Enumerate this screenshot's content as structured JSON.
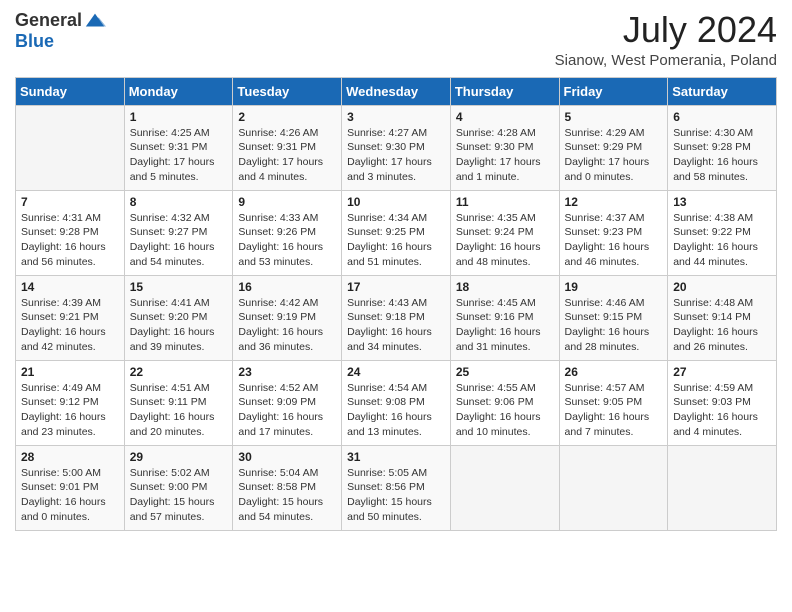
{
  "header": {
    "logo_general": "General",
    "logo_blue": "Blue",
    "title": "July 2024",
    "location": "Sianow, West Pomerania, Poland"
  },
  "days_of_week": [
    "Sunday",
    "Monday",
    "Tuesday",
    "Wednesday",
    "Thursday",
    "Friday",
    "Saturday"
  ],
  "weeks": [
    [
      {
        "day": "",
        "info": ""
      },
      {
        "day": "1",
        "info": "Sunrise: 4:25 AM\nSunset: 9:31 PM\nDaylight: 17 hours\nand 5 minutes."
      },
      {
        "day": "2",
        "info": "Sunrise: 4:26 AM\nSunset: 9:31 PM\nDaylight: 17 hours\nand 4 minutes."
      },
      {
        "day": "3",
        "info": "Sunrise: 4:27 AM\nSunset: 9:30 PM\nDaylight: 17 hours\nand 3 minutes."
      },
      {
        "day": "4",
        "info": "Sunrise: 4:28 AM\nSunset: 9:30 PM\nDaylight: 17 hours\nand 1 minute."
      },
      {
        "day": "5",
        "info": "Sunrise: 4:29 AM\nSunset: 9:29 PM\nDaylight: 17 hours\nand 0 minutes."
      },
      {
        "day": "6",
        "info": "Sunrise: 4:30 AM\nSunset: 9:28 PM\nDaylight: 16 hours\nand 58 minutes."
      }
    ],
    [
      {
        "day": "7",
        "info": "Sunrise: 4:31 AM\nSunset: 9:28 PM\nDaylight: 16 hours\nand 56 minutes."
      },
      {
        "day": "8",
        "info": "Sunrise: 4:32 AM\nSunset: 9:27 PM\nDaylight: 16 hours\nand 54 minutes."
      },
      {
        "day": "9",
        "info": "Sunrise: 4:33 AM\nSunset: 9:26 PM\nDaylight: 16 hours\nand 53 minutes."
      },
      {
        "day": "10",
        "info": "Sunrise: 4:34 AM\nSunset: 9:25 PM\nDaylight: 16 hours\nand 51 minutes."
      },
      {
        "day": "11",
        "info": "Sunrise: 4:35 AM\nSunset: 9:24 PM\nDaylight: 16 hours\nand 48 minutes."
      },
      {
        "day": "12",
        "info": "Sunrise: 4:37 AM\nSunset: 9:23 PM\nDaylight: 16 hours\nand 46 minutes."
      },
      {
        "day": "13",
        "info": "Sunrise: 4:38 AM\nSunset: 9:22 PM\nDaylight: 16 hours\nand 44 minutes."
      }
    ],
    [
      {
        "day": "14",
        "info": "Sunrise: 4:39 AM\nSunset: 9:21 PM\nDaylight: 16 hours\nand 42 minutes."
      },
      {
        "day": "15",
        "info": "Sunrise: 4:41 AM\nSunset: 9:20 PM\nDaylight: 16 hours\nand 39 minutes."
      },
      {
        "day": "16",
        "info": "Sunrise: 4:42 AM\nSunset: 9:19 PM\nDaylight: 16 hours\nand 36 minutes."
      },
      {
        "day": "17",
        "info": "Sunrise: 4:43 AM\nSunset: 9:18 PM\nDaylight: 16 hours\nand 34 minutes."
      },
      {
        "day": "18",
        "info": "Sunrise: 4:45 AM\nSunset: 9:16 PM\nDaylight: 16 hours\nand 31 minutes."
      },
      {
        "day": "19",
        "info": "Sunrise: 4:46 AM\nSunset: 9:15 PM\nDaylight: 16 hours\nand 28 minutes."
      },
      {
        "day": "20",
        "info": "Sunrise: 4:48 AM\nSunset: 9:14 PM\nDaylight: 16 hours\nand 26 minutes."
      }
    ],
    [
      {
        "day": "21",
        "info": "Sunrise: 4:49 AM\nSunset: 9:12 PM\nDaylight: 16 hours\nand 23 minutes."
      },
      {
        "day": "22",
        "info": "Sunrise: 4:51 AM\nSunset: 9:11 PM\nDaylight: 16 hours\nand 20 minutes."
      },
      {
        "day": "23",
        "info": "Sunrise: 4:52 AM\nSunset: 9:09 PM\nDaylight: 16 hours\nand 17 minutes."
      },
      {
        "day": "24",
        "info": "Sunrise: 4:54 AM\nSunset: 9:08 PM\nDaylight: 16 hours\nand 13 minutes."
      },
      {
        "day": "25",
        "info": "Sunrise: 4:55 AM\nSunset: 9:06 PM\nDaylight: 16 hours\nand 10 minutes."
      },
      {
        "day": "26",
        "info": "Sunrise: 4:57 AM\nSunset: 9:05 PM\nDaylight: 16 hours\nand 7 minutes."
      },
      {
        "day": "27",
        "info": "Sunrise: 4:59 AM\nSunset: 9:03 PM\nDaylight: 16 hours\nand 4 minutes."
      }
    ],
    [
      {
        "day": "28",
        "info": "Sunrise: 5:00 AM\nSunset: 9:01 PM\nDaylight: 16 hours\nand 0 minutes."
      },
      {
        "day": "29",
        "info": "Sunrise: 5:02 AM\nSunset: 9:00 PM\nDaylight: 15 hours\nand 57 minutes."
      },
      {
        "day": "30",
        "info": "Sunrise: 5:04 AM\nSunset: 8:58 PM\nDaylight: 15 hours\nand 54 minutes."
      },
      {
        "day": "31",
        "info": "Sunrise: 5:05 AM\nSunset: 8:56 PM\nDaylight: 15 hours\nand 50 minutes."
      },
      {
        "day": "",
        "info": ""
      },
      {
        "day": "",
        "info": ""
      },
      {
        "day": "",
        "info": ""
      }
    ]
  ]
}
